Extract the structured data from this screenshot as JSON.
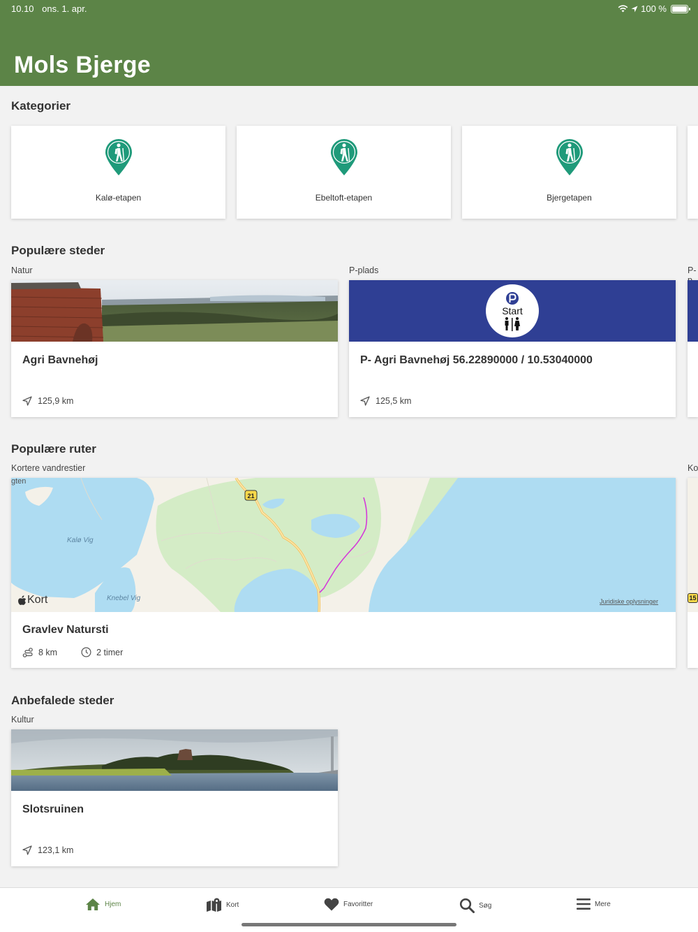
{
  "status_bar": {
    "time": "10.10",
    "date": "ons. 1. apr.",
    "battery": "100 %"
  },
  "header": {
    "title": "Mols Bjerge"
  },
  "categories": {
    "title": "Kategorier",
    "items": [
      {
        "label": "Kalø-etapen"
      },
      {
        "label": "Ebeltoft-etapen"
      },
      {
        "label": "Bjergetapen"
      }
    ]
  },
  "popular_places": {
    "title": "Populære steder",
    "items": [
      {
        "category": "Natur",
        "name": "Agri Bavnehøj",
        "distance": "125,9 km"
      },
      {
        "category": "P-plads",
        "name": "P- Agri Bavnehøj 56.22890000 / 10.53040000",
        "distance": "125,5 km",
        "badge_text": "Start"
      }
    ],
    "next_category": "P-p"
  },
  "popular_routes": {
    "title": "Populære ruter",
    "category": "Kortere vandrestier",
    "next_category": "Kor",
    "route": {
      "name": "Gravlev Natursti",
      "length": "8 km",
      "duration": "2 timer",
      "map": {
        "brand": "Kort",
        "legal": "Juridiske oplysninger",
        "labels": [
          "gten",
          "Kalø Vig",
          "Knebel Vig"
        ],
        "road_number": "21",
        "edge_road_number": "15"
      }
    }
  },
  "recommended": {
    "title": "Anbefalede steder",
    "category": "Kultur",
    "item": {
      "name": "Slotsruinen",
      "distance": "123,1 km"
    }
  },
  "tabbar": {
    "items": [
      {
        "label": "Hjem",
        "active": true
      },
      {
        "label": "Kort"
      },
      {
        "label": "Favoritter"
      },
      {
        "label": "Søg"
      },
      {
        "label": "Mere"
      }
    ]
  },
  "colors": {
    "header_green": "#5c8447",
    "pin_green": "#1f9a7a",
    "parking_blue": "#2f3f94",
    "route_magenta": "#d43ad9"
  }
}
